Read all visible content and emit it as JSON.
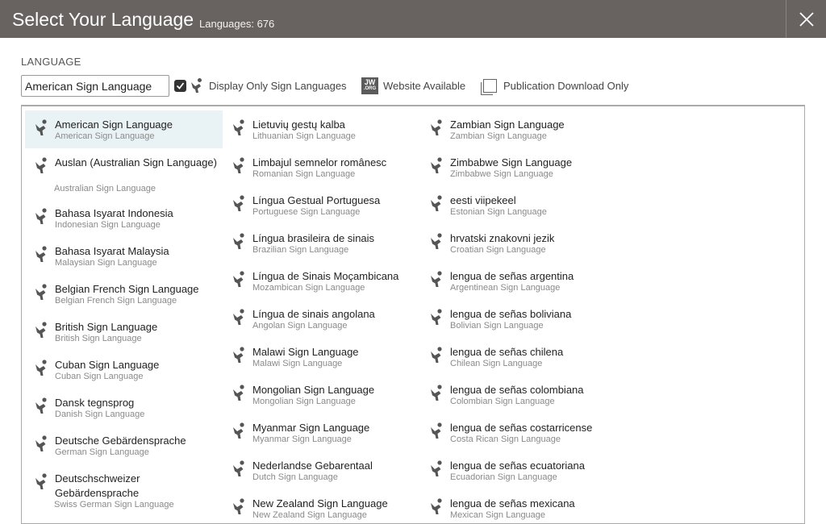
{
  "header": {
    "title": "Select Your Language",
    "count": "Languages: 676"
  },
  "search": {
    "label": "LANGUAGE",
    "value": "American Sign Language"
  },
  "filters": {
    "sign_only": {
      "label": "Display Only Sign Languages",
      "checked": true
    },
    "website": {
      "label": "Website Available",
      "badge_top": "JW",
      "badge_bottom": ".ORG"
    },
    "publication": {
      "label": "Publication Download Only",
      "checked": false
    }
  },
  "columns": [
    [
      {
        "name": "American Sign Language",
        "sub": "American Sign Language",
        "selected": true
      },
      {
        "name": "Auslan (Australian Sign Language)",
        "sub": "Australian Sign Language",
        "tall": true
      },
      {
        "name": "Bahasa Isyarat Indonesia",
        "sub": "Indonesian Sign Language"
      },
      {
        "name": "Bahasa Isyarat Malaysia",
        "sub": "Malaysian Sign Language"
      },
      {
        "name": "Belgian French Sign Language",
        "sub": "Belgian French Sign Language"
      },
      {
        "name": "British Sign Language",
        "sub": "British Sign Language"
      },
      {
        "name": "Cuban Sign Language",
        "sub": "Cuban Sign Language"
      },
      {
        "name": "Dansk tegnsprog",
        "sub": "Danish Sign Language"
      },
      {
        "name": "Deutsche Gebärdensprache",
        "sub": "German Sign Language"
      },
      {
        "name": "Deutschschweizer Gebärdensprache",
        "sub": "Swiss German Sign Language",
        "tall": true
      }
    ],
    [
      {
        "name": "Lietuvių gestų kalba",
        "sub": "Lithuanian Sign Language"
      },
      {
        "name": "Limbajul semnelor românesc",
        "sub": "Romanian Sign Language"
      },
      {
        "name": "Língua Gestual Portuguesa",
        "sub": "Portuguese Sign Language"
      },
      {
        "name": "Língua brasileira de sinais",
        "sub": "Brazilian Sign Language"
      },
      {
        "name": "Língua de Sinais Moçambicana",
        "sub": "Mozambican Sign Language"
      },
      {
        "name": "Língua de sinais angolana",
        "sub": "Angolan Sign Language"
      },
      {
        "name": "Malawi Sign Language",
        "sub": "Malawi Sign Language"
      },
      {
        "name": "Mongolian Sign Language",
        "sub": "Mongolian Sign Language"
      },
      {
        "name": "Myanmar Sign Language",
        "sub": "Myanmar Sign Language"
      },
      {
        "name": "Nederlandse Gebarentaal",
        "sub": "Dutch Sign Language"
      },
      {
        "name": "New Zealand Sign Language",
        "sub": "New Zealand Sign Language"
      }
    ],
    [
      {
        "name": "Zambian Sign Language",
        "sub": "Zambian Sign Language"
      },
      {
        "name": "Zimbabwe Sign Language",
        "sub": "Zimbabwe Sign Language"
      },
      {
        "name": "eesti viipekeel",
        "sub": "Estonian Sign Language"
      },
      {
        "name": "hrvatski znakovni jezik",
        "sub": "Croatian Sign Language"
      },
      {
        "name": "lengua de señas argentina",
        "sub": "Argentinean Sign Language"
      },
      {
        "name": "lengua de señas boliviana",
        "sub": "Bolivian Sign Language"
      },
      {
        "name": "lengua de señas chilena",
        "sub": "Chilean Sign Language"
      },
      {
        "name": "lengua de señas colombiana",
        "sub": "Colombian Sign Language"
      },
      {
        "name": "lengua de señas costarricense",
        "sub": "Costa Rican Sign Language"
      },
      {
        "name": "lengua de señas ecuatoriana",
        "sub": "Ecuadorian Sign Language"
      },
      {
        "name": "lengua de señas mexicana",
        "sub": "Mexican Sign Language"
      }
    ]
  ],
  "icons": {
    "sign_language": "sign-language-icon",
    "close": "close-icon"
  },
  "colors": {
    "header_bg": "#686360",
    "selected_bg": "#e9f3f5"
  }
}
